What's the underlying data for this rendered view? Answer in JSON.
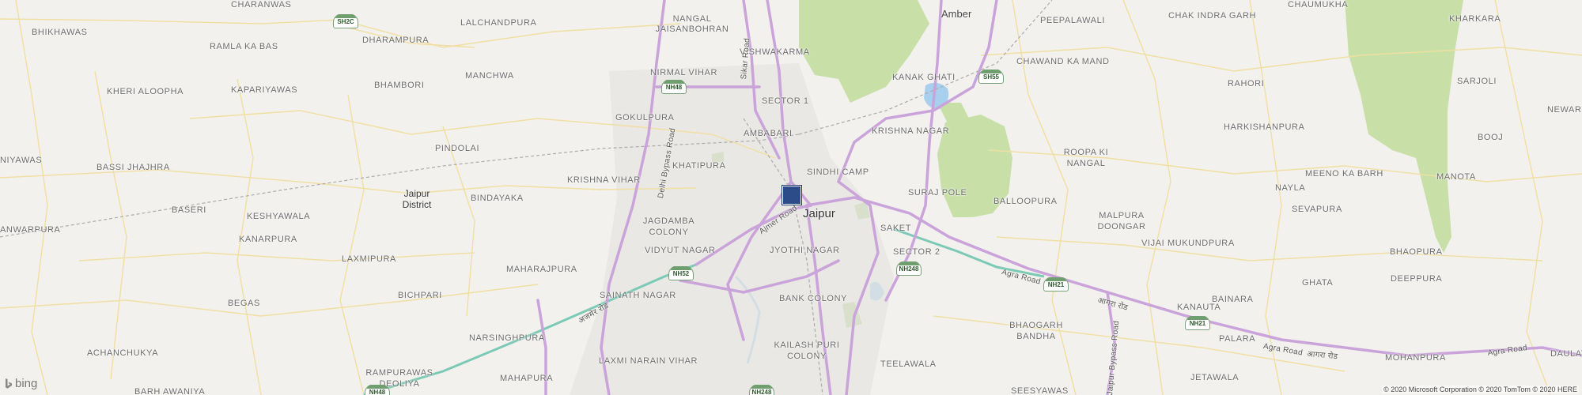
{
  "map": {
    "city": "Jaipur",
    "district": "Jaipur District",
    "towns": [
      "Amber"
    ],
    "localities": [
      "CHARANWAS",
      "BHIKHAWAS",
      "RAMLA KA BAS",
      "LALCHANDPURA",
      "NANGAL JAISANBOHRAN",
      "DHARAMPURA",
      "VISHWAKARMA",
      "BHAMBORI",
      "MANCHWA",
      "NIRMAL VIHAR",
      "SECTOR 1",
      "KHERI ALOOPHA",
      "KAPARIYAWAS",
      "GOKULPURA",
      "AMBABARI",
      "PINDOLAI",
      "KHATIPURA",
      "NIYAWAS",
      "BASSI JHAJHRA",
      "KRISHNA VIHAR",
      "SINDHI CAMP",
      "BINDAYAKA",
      "BASERI",
      "KESHYAWALA",
      "JAGDAMBA COLONY",
      "ANWARPURA",
      "KANARPURA",
      "VIDYUT NAGAR",
      "JYOTHI NAGAR",
      "LAXMIPURA",
      "MAHARAJPURA",
      "BICHPARI",
      "SAINATH NAGAR",
      "BANK COLONY",
      "BEGAS",
      "NARSINGHPURA",
      "ACHANCHUKYA",
      "RAMPURAWAS DEOLIYA",
      "LAXMI NARAIN VIHAR",
      "KAILASH PURI COLONY",
      "MAHAPURA",
      "BARH AWANIYA",
      "PEEPALAWALI",
      "CHAK INDRA GARH",
      "CHAUMUKHA",
      "KHARKARA",
      "KANAK GHATI",
      "CHAWAND KA MAND",
      "RAHORI",
      "SARJOLI",
      "NEWAR",
      "KRISHNA NAGAR",
      "HARKISHANPURA",
      "BOOJ",
      "ROOPA KI NANGAL",
      "SURAJ POLE",
      "BALLOOPURA",
      "NAYLA",
      "MEENO KA BARH",
      "MANOTA",
      "SAKET",
      "MALPURA DOONGAR",
      "SEVAPURA",
      "SECTOR 2",
      "VIJAI MUKUNDPURA",
      "BHAOPURA",
      "GHATA",
      "DEEPPURA",
      "BAINARA",
      "KANAUTA",
      "BHAOGARH BANDHA",
      "PALARA",
      "TEELAWALA",
      "MOHANPURA",
      "SEESYAWAS",
      "JETAWALA",
      "DAULAT"
    ],
    "roads": [
      "Sikar Road",
      "Delhi Bypass Road",
      "Ajmer Road",
      "Agra Road",
      "Jaipur Bypass Road",
      "अजमेर रोड",
      "आगरा रोड"
    ],
    "shields": [
      "SH2C",
      "NH48",
      "SH55",
      "NH52",
      "NH248",
      "NH21",
      "NH21",
      "NH48",
      "NH248"
    ],
    "colors": {
      "background": "#f2f1ee",
      "highway": "#c9a3d9",
      "expressway": "#7ccab6",
      "forest": "#c8e0a8",
      "water": "#a9cfee",
      "marker": "#2b4c88"
    }
  },
  "branding": {
    "logo": "bing",
    "copyright": "© 2020 Microsoft Corporation © 2020 TomTom © 2020 HERE"
  }
}
